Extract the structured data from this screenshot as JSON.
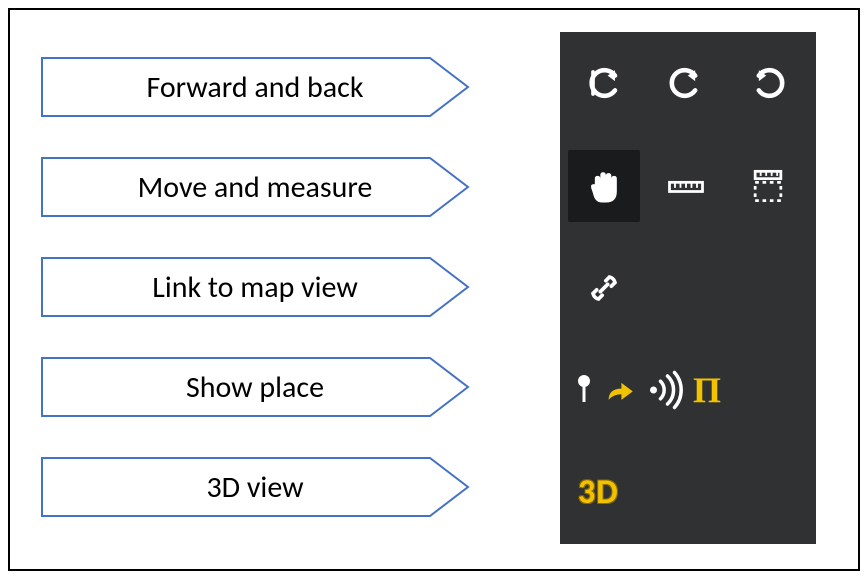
{
  "labels": {
    "row1": "Forward and back",
    "row2": "Move and measure",
    "row3": "Link to map view",
    "row4": "Show place",
    "row5": "3D view"
  },
  "toolbar": {
    "row1": {
      "icons": [
        "full-back-icon",
        "undo-icon",
        "redo-icon"
      ]
    },
    "row2": {
      "icons": [
        "hand-pan-icon",
        "ruler-icon",
        "area-measure-icon"
      ],
      "active": "hand-pan-icon"
    },
    "row3": {
      "icons": [
        "link-icon"
      ]
    },
    "row4": {
      "icons": [
        "pin-icon",
        "share-arrow-icon",
        "broadcast-icon",
        "pi-icon"
      ]
    },
    "row5": {
      "text": "3D"
    }
  },
  "colors": {
    "toolbar_bg": "#2f3133",
    "toolbar_active_bg": "#1a1b1c",
    "icon_white": "#ffffff",
    "icon_yellow": "#f2c200",
    "label_border": "#4472c4"
  }
}
